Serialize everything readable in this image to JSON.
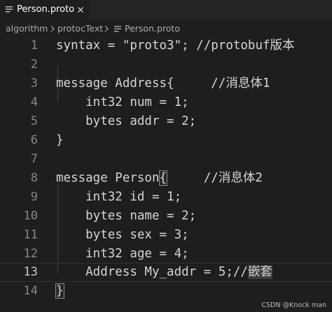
{
  "tab": {
    "title": "Person.proto",
    "icon": "lines-file-icon",
    "close_icon": "close-icon"
  },
  "breadcrumb": {
    "items": [
      "algorithm",
      "protocText",
      "Person.proto"
    ],
    "separator_icon": "chevron-right-icon",
    "file_icon": "lines-file-icon"
  },
  "editor": {
    "current_line": 13,
    "lines": [
      {
        "num": "1",
        "text": "syntax = \"proto3\"; //protobuf版本"
      },
      {
        "num": "2",
        "text": ""
      },
      {
        "num": "3",
        "text": "message Address{     //消息体1"
      },
      {
        "num": "4",
        "text": "    int32 num = 1;"
      },
      {
        "num": "5",
        "text": "    bytes addr = 2;"
      },
      {
        "num": "6",
        "text": "}"
      },
      {
        "num": "7",
        "text": ""
      },
      {
        "num": "8",
        "text": "message Person",
        "brace": "{",
        "rest": "     //消息体2"
      },
      {
        "num": "9",
        "text": "    int32 id = 1;"
      },
      {
        "num": "10",
        "text": "    bytes name = 2;"
      },
      {
        "num": "11",
        "text": "    bytes sex = 3;"
      },
      {
        "num": "12",
        "text": "    int32 age = 4;"
      },
      {
        "num": "13",
        "text": "    Address My_addr = 5;//",
        "selected": "嵌套"
      },
      {
        "num": "14",
        "brace": "}",
        "text": ""
      }
    ]
  },
  "watermark": "CSDN @Knock man",
  "colors": {
    "background": "#1e1e1e",
    "text": "#d4d4d4",
    "line_number": "#858585",
    "tab_bar": "#252526"
  }
}
